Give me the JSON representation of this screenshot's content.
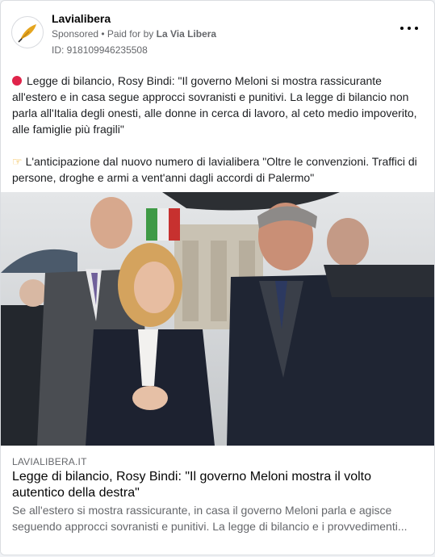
{
  "ad": {
    "page_name": "Lavialibera",
    "sponsored": "Sponsored",
    "paid_prefix": " • Paid for by ",
    "paid_by": "La Via Libera",
    "library_id": "ID: 918109946235508",
    "more_icon": "more-horizontal-icon",
    "logo_icon": "quill-pen-icon"
  },
  "body": {
    "para1_icon": "red-circle-icon",
    "para1": "Legge di bilancio, Rosy Bindi: \"Il governo Meloni si mostra rassicurante all'estero e in casa segue approcci sovranisti e punitivi. La legge di bilancio non parla all'Italia degli onesti, alle donne in cerca di lavoro, al ceto medio impoverito, alle famiglie più fragili\"",
    "para2_icon": "pointing-finger-icon",
    "para2": "L'anticipazione dal nuovo numero di lavialibera \"Oltre le convenzioni. Traffici di persone, droghe e armi a vent'anni dagli accordi di Palermo\""
  },
  "link": {
    "domain": "LAVIALIBERA.IT",
    "title": "Legge di bilancio, Rosy Bindi: \"Il governo Meloni mostra il volto autentico della destra\"",
    "description": "Se all'estero si mostra rassicurante, in casa il governo Meloni parla e agisce seguendo approcci sovranisti e punitivi. La legge di bilancio e i provvedimenti..."
  },
  "colors": {
    "accent_red": "#e0244a",
    "logo_gold": "#e5a51f"
  }
}
